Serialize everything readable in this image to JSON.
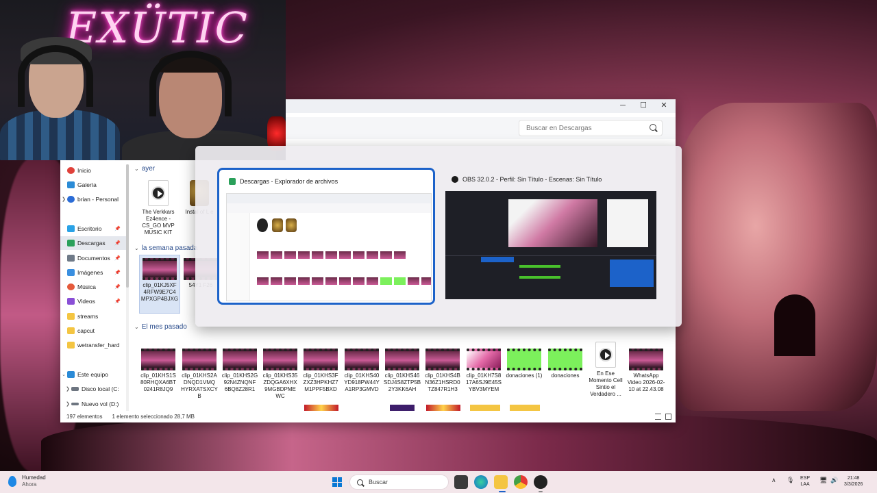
{
  "webcam": {
    "neon_sign": "EXÜTIC"
  },
  "explorer": {
    "search_placeholder": "Buscar en Descargas",
    "nav": [
      {
        "label": "Inicio",
        "icon": "home-icon",
        "color": "#e0413a"
      },
      {
        "label": "Galería",
        "icon": "gallery-icon",
        "color": "#2b8bd6"
      },
      {
        "label": "brian - Personal",
        "icon": "cloud-icon",
        "color": "#2b6cd6"
      },
      {
        "label": "Escritorio",
        "icon": "desktop-icon",
        "color": "#2aa2e6"
      },
      {
        "label": "Descargas",
        "icon": "download-icon",
        "color": "#2aa05a"
      },
      {
        "label": "Documentos",
        "icon": "documents-icon",
        "color": "#6f7a88"
      },
      {
        "label": "Imágenes",
        "icon": "pictures-icon",
        "color": "#3a8fe0"
      },
      {
        "label": "Música",
        "icon": "music-icon",
        "color": "#e55a3b"
      },
      {
        "label": "Videos",
        "icon": "videos-icon",
        "color": "#8a4fd6"
      },
      {
        "label": "streams",
        "icon": "folder-icon",
        "color": "#f4c542"
      },
      {
        "label": "capcut",
        "icon": "folder-icon",
        "color": "#f4c542"
      },
      {
        "label": "wetransfer_hard",
        "icon": "folder-icon",
        "color": "#f4c542"
      },
      {
        "label": "Este equipo",
        "icon": "pc-icon",
        "color": "#2a8ad6"
      },
      {
        "label": "Disco local (C:",
        "icon": "drive-icon",
        "color": "#6d7580"
      },
      {
        "label": "Nuevo vol (D:)",
        "icon": "drive-icon",
        "color": "#6d7580"
      }
    ],
    "groups": {
      "yesterday": "ayer",
      "last_week": "la semana pasada",
      "last_month": "El mes pasado"
    },
    "files_yesterday": [
      "The Verkkars Ez4ence - CS_GO MVP MUSIC KIT",
      "Instal of L e"
    ],
    "files_last_week": [
      "clip_01KJ5XF 4RFW9E7C4 MPXGP4BJXG",
      "54Y1 F26"
    ],
    "files_last_month": [
      "clip_01KHS1S 80RHQXA6BT 0241R8JQ9",
      "clip_01KHS2A DNQD1VMQ HYRXATSXCY B",
      "clip_01KHS2G 92N4ZNQNF 6BQ8Z28R1",
      "clip_01KHS35 ZDQGA6XHX 9MGBDPME WC",
      "clip_01KHS3F ZXZ3HPKHZ7 M1PPF5BXD",
      "clip_01KHS40 YD918PW44Y A1RP3GMVD",
      "clip_01KHS46 SDJ4S8ZTP5B 2Y3KK6AH",
      "clip_01KHS4B N36Z1HSRD0 TZ847R1H3",
      "clip_01KH7S8 17A6SJ9E45S YBV3MYEM",
      "donaciones (1)",
      "donaciones",
      "En Ese Momento Cell Sintio el Verdadero ...",
      "WhatsApp Video 2026-02-10 at 22.43.08"
    ],
    "status": {
      "count": "197 elementos",
      "selection": "1 elemento seleccionado  28,7 MB"
    }
  },
  "switcher": {
    "cards": [
      {
        "title": "Descargas - Explorador de archivos",
        "icon": "download-icon"
      },
      {
        "title": "OBS 32.0.2 - Perfil: Sin Título - Escenas: Sin Título",
        "icon": "obs-icon"
      }
    ]
  },
  "taskbar": {
    "weather_title": "Humedad",
    "weather_sub": "Ahora",
    "search_placeholder": "Buscar",
    "lang_top": "ESP",
    "lang_bottom": "LAA",
    "time": "21:48",
    "date": "3/3/2026"
  }
}
